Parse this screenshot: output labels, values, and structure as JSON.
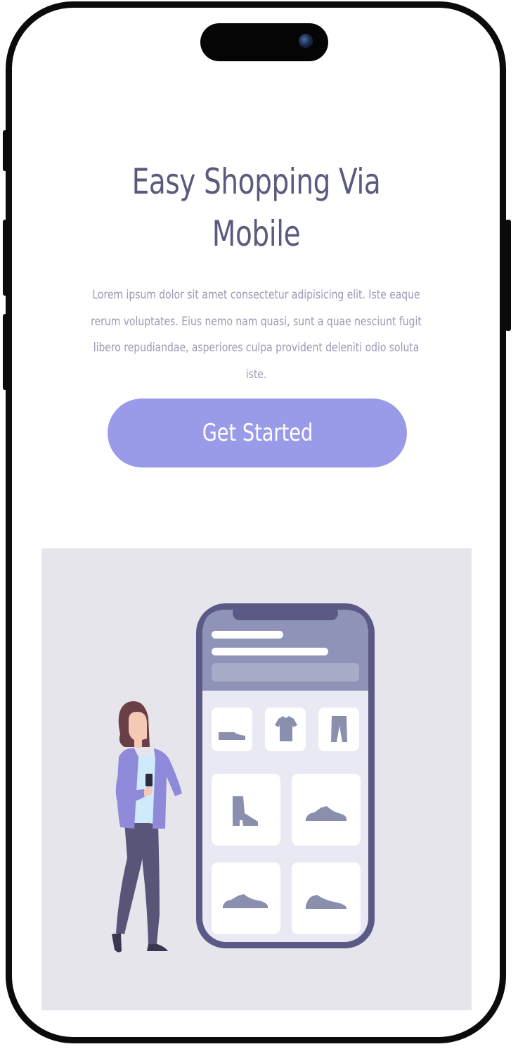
{
  "hero": {
    "title": "Easy Shopping Via Mobile",
    "description": "Lorem ipsum dolor sit amet consectetur adipisicing elit. Iste eaque rerum voluptates. Eius nemo nam quasi, sunt a quae nesciunt fugit libero repudiandae, asperiores culpa provident deleniti odio soluta iste.",
    "cta_label": "Get Started"
  },
  "illustration": {
    "subject": "woman-with-phone-beside-shopping-app",
    "product_icons": [
      "shoe-icon",
      "tshirt-icon",
      "pants-icon",
      "boot-icon",
      "sneaker-icon",
      "sneaker-icon",
      "sneaker-icon"
    ]
  },
  "colors": {
    "title": "#5a5a7e",
    "body_text": "#9a9ab4",
    "accent": "#9a9be8",
    "illustration_bg": "#e6e5ec",
    "phone_body": "#5b5a86",
    "phone_header": "#8f93b8",
    "product_icon": "#8a8fae"
  }
}
